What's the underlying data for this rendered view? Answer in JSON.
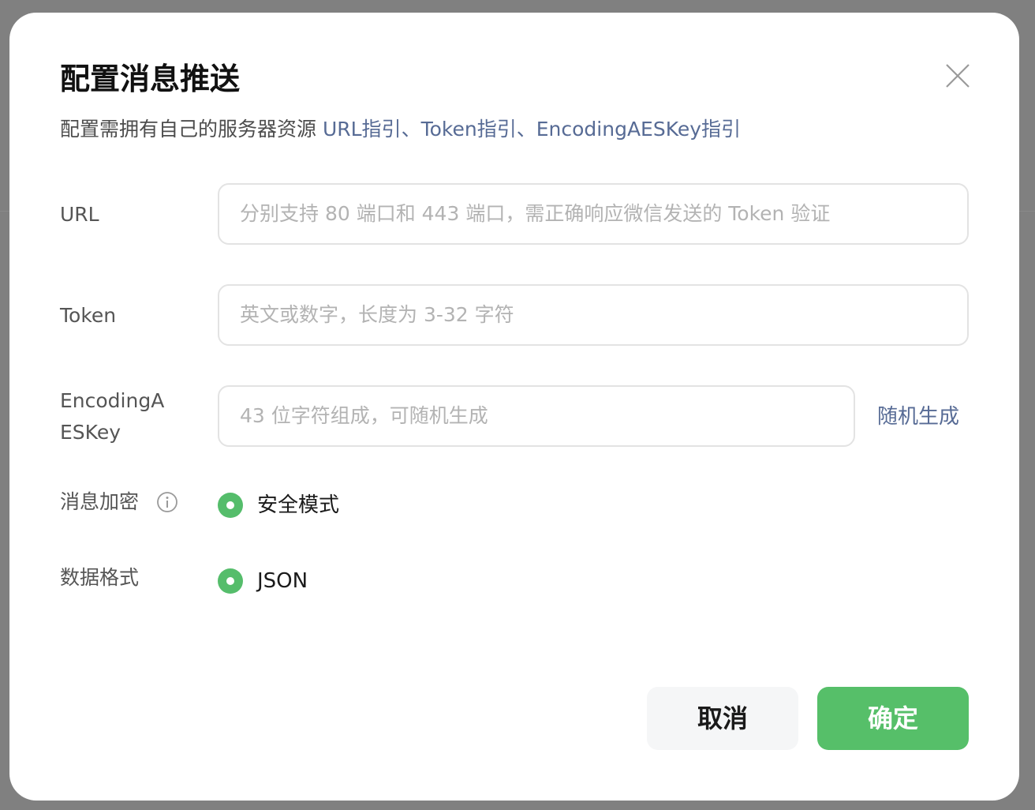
{
  "dialog": {
    "title": "配置消息推送",
    "description": "配置需拥有自己的服务器资源 ",
    "links": {
      "url_guide": "URL指引",
      "sep1": "、",
      "token_guide": "Token指引",
      "sep2": "、",
      "aeskey_guide": "EncodingAESKey指引"
    }
  },
  "form": {
    "url": {
      "label": "URL",
      "placeholder": "分别支持 80 端口和 443 端口，需正确响应微信发送的 Token 验证"
    },
    "token": {
      "label": "Token",
      "placeholder": "英文或数字，长度为 3-32 字符"
    },
    "aeskey": {
      "label_line1": "EncodingA",
      "label_line2": "ESKey",
      "placeholder": "43 位字符组成，可随机生成",
      "random_label": "随机生成"
    },
    "encryption": {
      "label": "消息加密",
      "option": "安全模式"
    },
    "format": {
      "label": "数据格式",
      "option": "JSON"
    }
  },
  "footer": {
    "cancel_label": "取消",
    "confirm_label": "确定"
  },
  "colors": {
    "accent": "#56bf69",
    "link": "#576b95"
  }
}
